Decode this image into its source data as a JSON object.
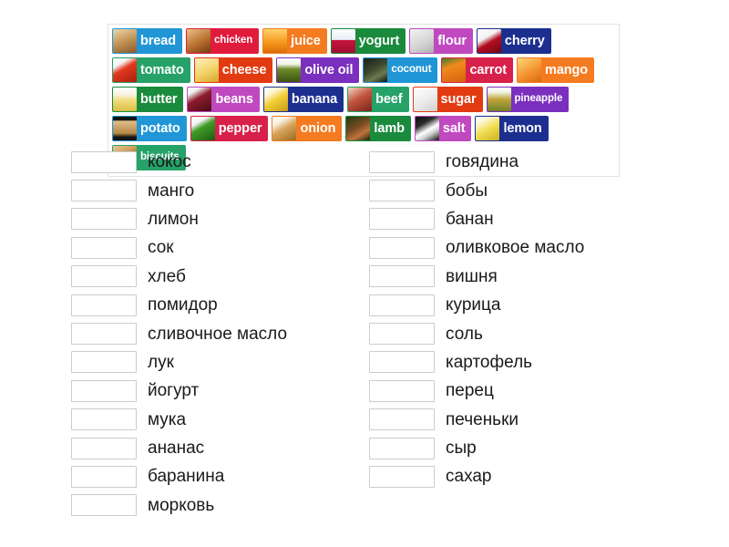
{
  "activity": {
    "type": "match-up",
    "tile_bank_label": "word-tiles"
  },
  "tiles": [
    {
      "label": "bread",
      "bg": "#2196d6",
      "thumb": "bread-image",
      "art": "bread"
    },
    {
      "label": "chicken",
      "bg": "#e01b3c",
      "thumb": "chicken-image",
      "art": "chicken",
      "small": true
    },
    {
      "label": "juice",
      "bg": "#f47b20",
      "thumb": "juice-image",
      "art": "juice"
    },
    {
      "label": "yogurt",
      "bg": "#1a8a3d",
      "thumb": "yogurt-image",
      "art": "yogurt"
    },
    {
      "label": "flour",
      "bg": "#c049c0",
      "thumb": "flour-image",
      "art": "flour"
    },
    {
      "label": "cherry",
      "bg": "#1c2f8f",
      "thumb": "cherry-image",
      "art": "cherry"
    },
    {
      "label": "tomato",
      "bg": "#26a269",
      "thumb": "tomato-image",
      "art": "tomato"
    },
    {
      "label": "cheese",
      "bg": "#e23b12",
      "thumb": "cheese-image",
      "art": "cheese"
    },
    {
      "label": "olive oil",
      "bg": "#7b2fbe",
      "thumb": "olive-oil-image",
      "art": "oliveoil"
    },
    {
      "label": "coconut",
      "bg": "#2196d6",
      "thumb": "coconut-image",
      "art": "coconut",
      "small": true
    },
    {
      "label": "carrot",
      "bg": "#d8214a",
      "thumb": "carrot-image",
      "art": "carrot"
    },
    {
      "label": "mango",
      "bg": "#f47b20",
      "thumb": "mango-image",
      "art": "mango"
    },
    {
      "label": "butter",
      "bg": "#1a8a3d",
      "thumb": "butter-image",
      "art": "butter"
    },
    {
      "label": "beans",
      "bg": "#c049c0",
      "thumb": "beans-image",
      "art": "beans"
    },
    {
      "label": "banana",
      "bg": "#1c2f8f",
      "thumb": "banana-image",
      "art": "banana"
    },
    {
      "label": "beef",
      "bg": "#26a269",
      "thumb": "beef-image",
      "art": "beef"
    },
    {
      "label": "sugar",
      "bg": "#e23b12",
      "thumb": "sugar-image",
      "art": "sugar"
    },
    {
      "label": "pineapple",
      "bg": "#7b2fbe",
      "thumb": "pineapple-image",
      "art": "pineapple",
      "small": true
    },
    {
      "label": "potato",
      "bg": "#2196d6",
      "thumb": "potato-image",
      "art": "potato"
    },
    {
      "label": "pepper",
      "bg": "#d8214a",
      "thumb": "pepper-image",
      "art": "pepper"
    },
    {
      "label": "onion",
      "bg": "#f47b20",
      "thumb": "onion-image",
      "art": "onion"
    },
    {
      "label": "lamb",
      "bg": "#1a8a3d",
      "thumb": "lamb-image",
      "art": "lamb"
    },
    {
      "label": "salt",
      "bg": "#c049c0",
      "thumb": "salt-image",
      "art": "salt"
    },
    {
      "label": "lemon",
      "bg": "#1c2f8f",
      "thumb": "lemon-image",
      "art": "lemon"
    },
    {
      "label": "biscuits",
      "bg": "#26a269",
      "thumb": "biscuits-image",
      "art": "biscuits",
      "small": true
    }
  ],
  "answers": {
    "left_column": [
      {
        "word": "кокос",
        "value": ""
      },
      {
        "word": "манго",
        "value": ""
      },
      {
        "word": "лимон",
        "value": ""
      },
      {
        "word": "сок",
        "value": ""
      },
      {
        "word": "хлеб",
        "value": ""
      },
      {
        "word": "помидор",
        "value": ""
      },
      {
        "word": "сливочное масло",
        "value": ""
      },
      {
        "word": "лук",
        "value": ""
      },
      {
        "word": "йогурт",
        "value": ""
      },
      {
        "word": "мука",
        "value": ""
      },
      {
        "word": "ананас",
        "value": ""
      },
      {
        "word": "баранина",
        "value": ""
      },
      {
        "word": "морковь",
        "value": ""
      }
    ],
    "right_column": [
      {
        "word": "говядина",
        "value": ""
      },
      {
        "word": "бобы",
        "value": ""
      },
      {
        "word": "банан",
        "value": ""
      },
      {
        "word": "оливковое масло",
        "value": ""
      },
      {
        "word": "вишня",
        "value": ""
      },
      {
        "word": "курица",
        "value": ""
      },
      {
        "word": "соль",
        "value": ""
      },
      {
        "word": "картофель",
        "value": ""
      },
      {
        "word": "перец",
        "value": ""
      },
      {
        "word": "печеньки",
        "value": ""
      },
      {
        "word": "сыр",
        "value": ""
      },
      {
        "word": "сахар",
        "value": ""
      }
    ]
  },
  "colors": {
    "blue": "#2196d6",
    "red": "#e01b3c",
    "orange": "#f47b20",
    "green": "#1a8a3d",
    "orchid": "#c049c0",
    "navy": "#1c2f8f",
    "seagreen": "#26a269",
    "purple": "#7b2fbe",
    "crimson": "#d8214a",
    "vermilion": "#e23b12",
    "page_bg": "#ffffff",
    "box_border": "#cccccc",
    "bank_border": "#e3e3e3",
    "text": "#1a1a1a"
  }
}
